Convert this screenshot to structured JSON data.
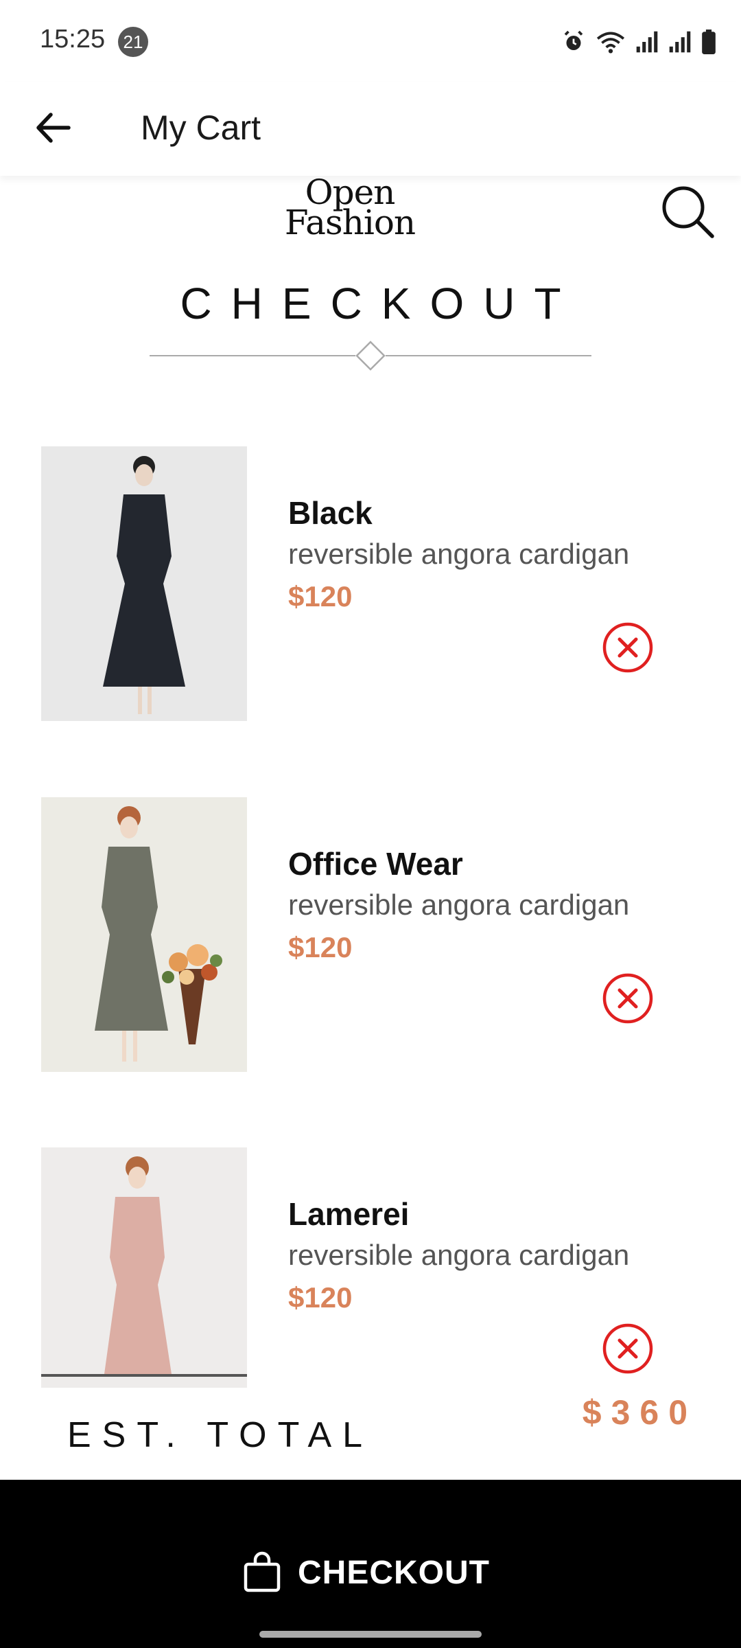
{
  "status_bar": {
    "time": "15:25",
    "notification_count": "21",
    "icons": [
      "alarm-icon",
      "wifi-icon",
      "signal-icon",
      "signal-icon",
      "battery-icon"
    ]
  },
  "app_bar": {
    "title": "My Cart",
    "back_icon": "arrow-left-icon"
  },
  "brand": {
    "line1": "Open",
    "line2": "Fashion",
    "search_icon": "search-icon"
  },
  "section_title": "CHECKOUT",
  "cart_items": [
    {
      "name": "Black",
      "description": "reversible angora cardigan",
      "price": "$120",
      "remove_icon": "close-circle-icon"
    },
    {
      "name": "Office Wear",
      "description": "reversible angora cardigan",
      "price": "$120",
      "remove_icon": "close-circle-icon"
    },
    {
      "name": "Lamerei",
      "description": "reversible angora cardigan",
      "price": "$120",
      "remove_icon": "close-circle-icon"
    }
  ],
  "total": {
    "label": "EST. TOTAL",
    "value": "$360"
  },
  "checkout_button": {
    "label": "CHECKOUT",
    "icon": "shopping-bag-icon"
  },
  "colors": {
    "price": "#d9835a",
    "remove": "#e02020",
    "checkout_bar": "#000000"
  }
}
